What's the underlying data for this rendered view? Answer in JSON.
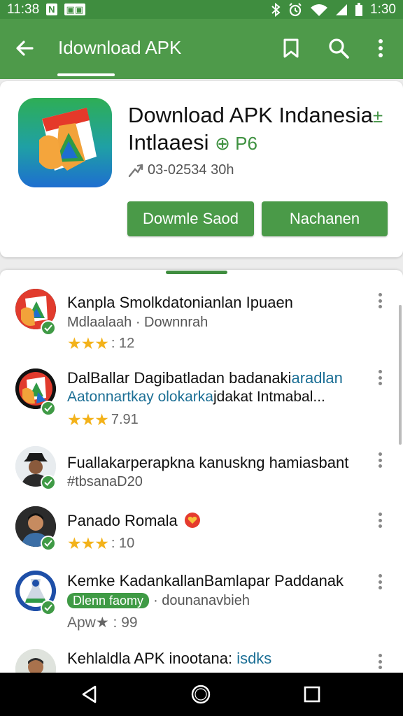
{
  "status": {
    "left_time": "11:38",
    "right_time": "1:30"
  },
  "appbar": {
    "title": "Idownload APK"
  },
  "app": {
    "name_line1": "Download APK Indanesia",
    "name_line1_mark": "±",
    "name_line2": "Intlaaesi",
    "name_line2_mark": "⊕ P6",
    "meta": "03-02534 30h",
    "button1": "Dowmle Saod",
    "button2": "Nachanen"
  },
  "list": [
    {
      "title": "Kanpla Smolkdatonianlan Ipuaen",
      "sub": "Mdlaalaah · Downnrah",
      "rating": "12",
      "stars": "★★★"
    },
    {
      "title_a": "DalBallar Dagibatladan badanaki",
      "title_b": "aradlan",
      "sub_a": "Aatonnartkay olokarka",
      "sub_b": "jdakat Intmabal...",
      "rating": "7.91",
      "stars": "★★★"
    },
    {
      "title": "Fuallakarperapkna kanuskng hamiasbant",
      "sub": "#tbsanaD20"
    },
    {
      "title": "Panado Romala",
      "rating": "10",
      "stars": "★★★"
    },
    {
      "title": "Kemke KadankallanBamlapar Paddanak",
      "tag": "Dlenn faomy",
      "sub": "· dounanavbieh",
      "rating_prefix": "Apw",
      "rating_star": "★",
      "rating": "99"
    },
    {
      "title_a": "Kehlaldla APK inootana: ",
      "title_b": "isdks"
    }
  ],
  "colors": {
    "green_primary": "#4e9a4a",
    "green_dark": "#3f8d3f",
    "star": "#f3b21a"
  },
  "icons": [
    "back-arrow-icon",
    "bookmark-icon",
    "search-icon",
    "more-vert-icon",
    "bluetooth-icon",
    "alarm-icon",
    "wifi-icon",
    "signal-icon",
    "battery-icon",
    "back-triangle-icon",
    "home-circle-icon",
    "recents-square-icon"
  ]
}
